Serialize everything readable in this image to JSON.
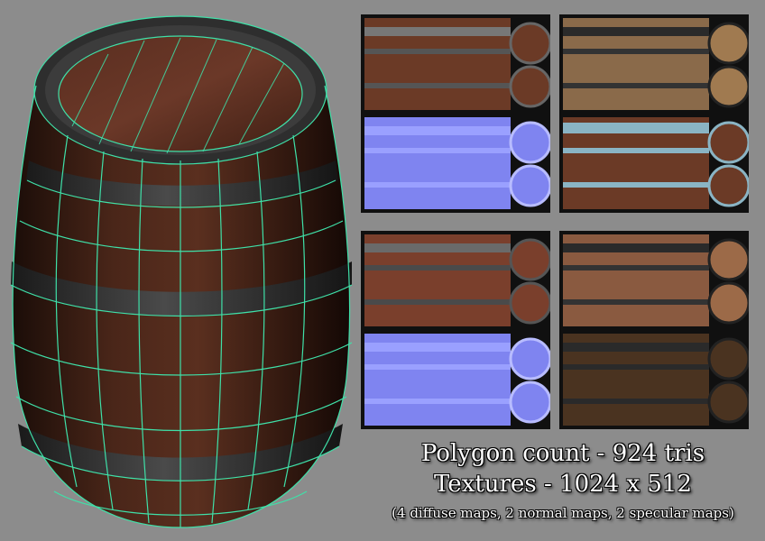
{
  "caption": {
    "polygon_count": "Polygon count - 924 tris",
    "textures": "Textures - 1024 x 512",
    "maps_note": "(4 diffuse maps, 2 normal maps, 2 specular maps)"
  },
  "textures": [
    {
      "kind": "diffuse"
    },
    {
      "kind": "specular"
    },
    {
      "kind": "normal"
    },
    {
      "kind": "diffuse"
    },
    {
      "kind": "diffuse"
    },
    {
      "kind": "specular"
    },
    {
      "kind": "normal"
    },
    {
      "kind": "diffuse"
    }
  ],
  "colors": {
    "background": "#8c8c8c",
    "wireframe": "#3fe0a8",
    "wood_dark": "#3a1e14",
    "wood_light": "#6b3a26",
    "metal_band": "#2b2b2b",
    "normal_map": "#7f84f0"
  }
}
